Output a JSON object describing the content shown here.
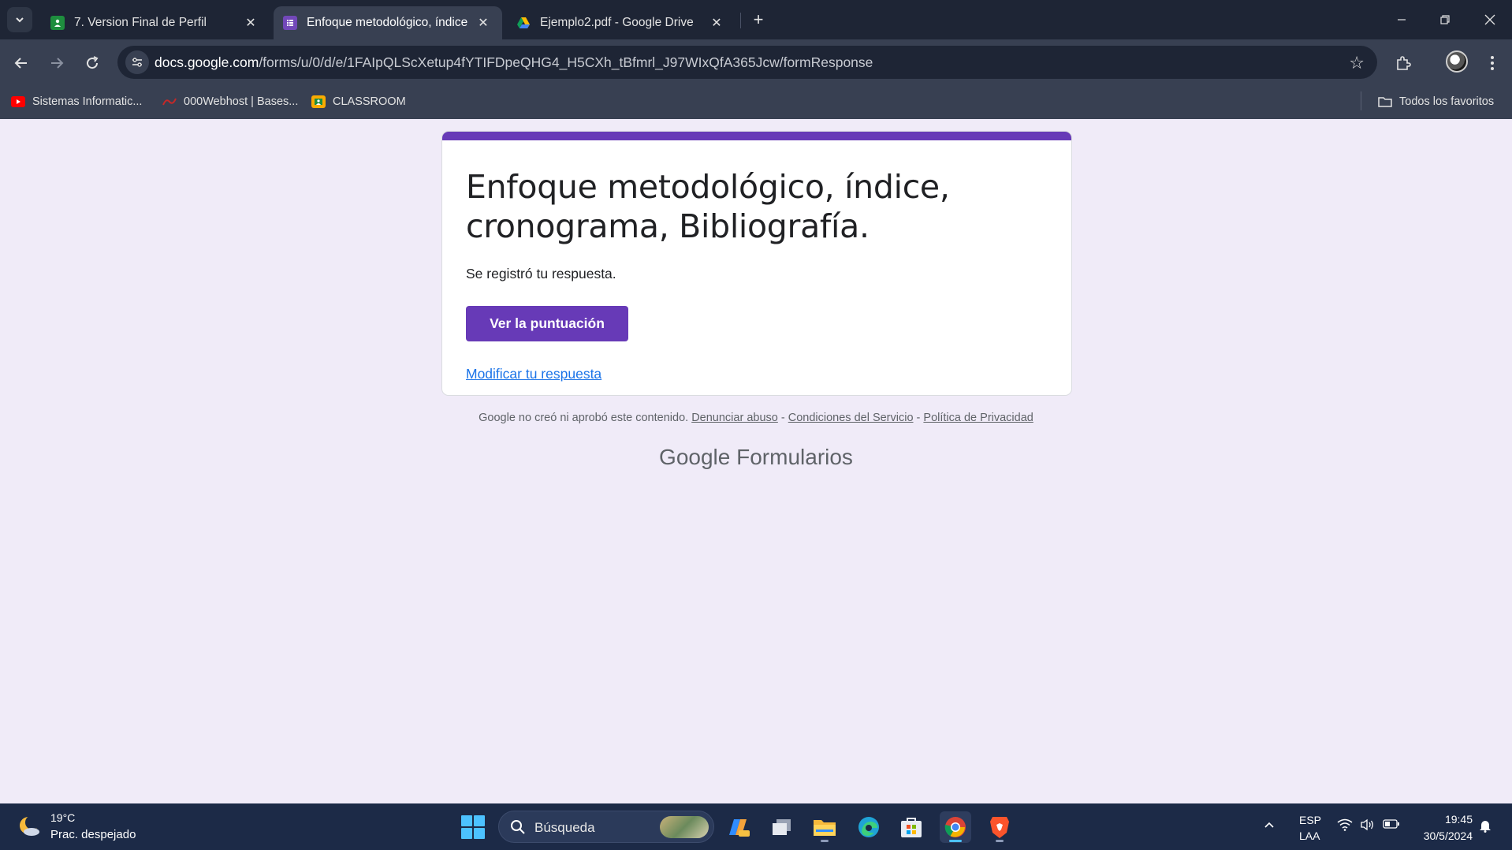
{
  "browser": {
    "tabs": [
      {
        "title": "7. Version Final de Perfil",
        "icon": "google-classroom-icon",
        "active": false
      },
      {
        "title": "Enfoque metodológico, índice, c",
        "icon": "google-forms-icon",
        "active": true
      },
      {
        "title": "Ejemplo2.pdf - Google Drive",
        "icon": "google-drive-icon",
        "active": false
      }
    ],
    "url_host": "docs.google.com",
    "url_path": "/forms/u/0/d/e/1FAIpQLScXetup4fYTIFDpeQHG4_H5CXh_tBfmrl_J97WIxQfA365Jcw/formResponse",
    "bookmarks": [
      {
        "label": "Sistemas Informatic...",
        "icon": "youtube-icon"
      },
      {
        "label": "000Webhost | Bases...",
        "icon": "000webhost-icon"
      },
      {
        "label": "CLASSROOM",
        "icon": "classroom-icon"
      }
    ],
    "all_bookmarks_label": "Todos los favoritos"
  },
  "form": {
    "title": "Enfoque metodológico, índice, cronograma, Bibliografía.",
    "confirmation": "Se registró tu respuesta.",
    "score_button": "Ver la puntuación",
    "edit_link": "Modificar tu respuesta",
    "accent_color": "#673ab7"
  },
  "footer": {
    "disclaimer": "Google no creó ni aprobó este contenido.",
    "sep": " - ",
    "abuse_link": "Denunciar abuso",
    "terms_link": "Condiciones del Servicio",
    "privacy_link": "Política de Privacidad",
    "brand_google": "Google",
    "brand_product": "Formularios"
  },
  "taskbar": {
    "weather_temp": "19°C",
    "weather_desc": "Prac. despejado",
    "search_placeholder": "Búsqueda",
    "lang_line1": "ESP",
    "lang_line2": "LAA",
    "time": "19:45",
    "date": "30/5/2024"
  }
}
